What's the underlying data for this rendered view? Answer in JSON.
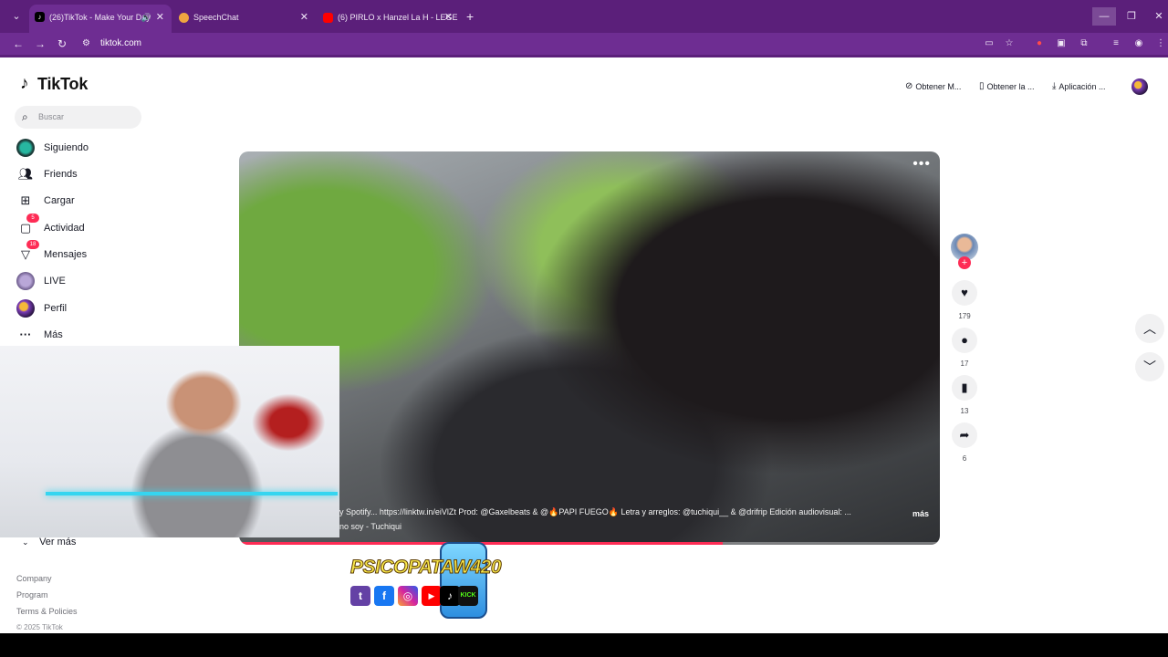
{
  "browser": {
    "tabs": [
      {
        "title": "(26)TikTok - Make Your Day",
        "active": true
      },
      {
        "title": "SpeechChat",
        "active": false
      },
      {
        "title": "(6) PIRLO x Hanzel La H - LEGE",
        "active": false
      }
    ],
    "url": "tiktok.com",
    "window_buttons": {
      "minimize": "—",
      "restore": "❐",
      "close": "✕"
    }
  },
  "tiktok": {
    "logo_text": "TikTok",
    "search_placeholder": "Buscar",
    "nav": [
      {
        "label": "Siguiendo",
        "icon": "following-icon"
      },
      {
        "label": "Friends",
        "icon": "friends-icon"
      },
      {
        "label": "Cargar",
        "icon": "upload-icon"
      },
      {
        "label": "Actividad",
        "icon": "activity-icon",
        "badge": "5"
      },
      {
        "label": "Mensajes",
        "icon": "messages-icon",
        "badge": "18"
      },
      {
        "label": "LIVE",
        "icon": "live-icon"
      },
      {
        "label": "Perfil",
        "icon": "profile-icon"
      },
      {
        "label": "Más",
        "icon": "more-icon"
      }
    ],
    "see_more": "Ver más",
    "footer_links": [
      "Company",
      "Program",
      "Terms & Policies"
    ],
    "copyright": "© 2025 TikTok",
    "top_actions": [
      "Obtener M...",
      "Obtener la ...",
      "Aplicación ..."
    ],
    "video": {
      "caption_line1": "y Spotify... https://linktw.in/eiVlZt Prod: @Gaxelbeats  & @🔥PAPI FUEGO🔥  Letra y arreglos: @tuchiqui__ & @drifrip  Edición audiovisual: ...",
      "caption_line2": "no soy - Tuchiqui",
      "more_label": "más",
      "progress": 0.69
    },
    "actions": {
      "likes": "179",
      "comments": "17",
      "saves": "13",
      "shares": "6"
    }
  },
  "overlay": {
    "streamer_name": "PSICOPATAW420",
    "socials": [
      "twitch",
      "facebook",
      "instagram",
      "youtube",
      "tiktok",
      "kick"
    ]
  }
}
